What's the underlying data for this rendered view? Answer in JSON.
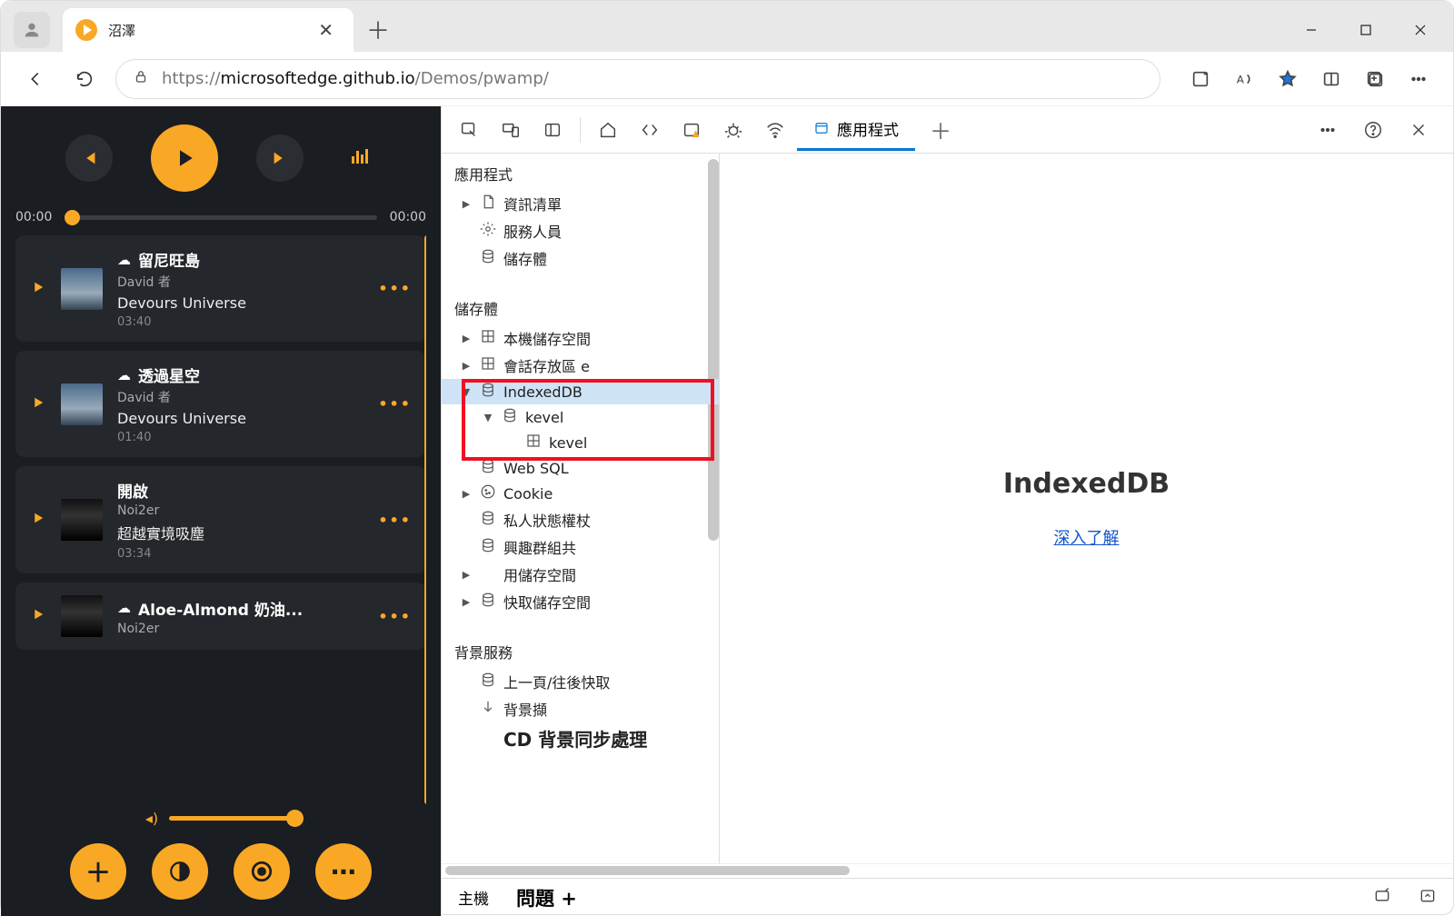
{
  "browser": {
    "tab_title": "沼澤",
    "url_prefix": "https://",
    "url_black": "microsoftedge.github.io",
    "url_rest": "/Demos/pwamp/"
  },
  "pwamp": {
    "t_elapsed": "00:00",
    "t_total": "00:00",
    "songs": [
      {
        "title": "留尼旺島",
        "artist": "David",
        "suffix": "者",
        "album": "Devours Universe",
        "dur": "03:40",
        "cloud": true,
        "cover": "light"
      },
      {
        "title": "透過星空",
        "artist": "David",
        "suffix": "者",
        "album": "Devours Universe",
        "dur": "01:40",
        "cloud": true,
        "cover": "light"
      },
      {
        "title": "開啟",
        "artist": "Noi2er",
        "suffix": "",
        "album": "超越實境吸塵",
        "dur": "03:34",
        "cloud": false,
        "cover": "dark"
      },
      {
        "title": "Aloe-Almond 奶油...",
        "artist": "Noi2er",
        "suffix": "",
        "album": "",
        "dur": "",
        "cloud": true,
        "cover": "dark"
      }
    ]
  },
  "devtools": {
    "tab_active": "應用程式",
    "main_title": "IndexedDB",
    "main_link": "深入了解",
    "drawer_main": "主機",
    "drawer_issues": "問題",
    "side": {
      "app_header": "應用程式",
      "app_items": [
        "資訊清單",
        "服務人員",
        "儲存體"
      ],
      "storage_header": "儲存體",
      "storage_items": [
        {
          "label": "本機儲存空間",
          "expand": "▶",
          "level": 1,
          "icon": "grid"
        },
        {
          "label": "會話存放區 e",
          "expand": "▶",
          "level": 1,
          "icon": "grid"
        },
        {
          "label": "IndexedDB",
          "expand": "▼",
          "level": 1,
          "sel": true,
          "icon": "db"
        },
        {
          "label": "kevel",
          "expand": "▼",
          "level": 2,
          "icon": "db"
        },
        {
          "label": "kevel",
          "expand": "",
          "level": 3,
          "icon": "grid"
        },
        {
          "label": "Web SQL",
          "expand": "",
          "level": 1,
          "icon": "db"
        },
        {
          "label": "Cookie",
          "expand": "▶",
          "level": 1,
          "icon": "cookie"
        },
        {
          "label": "私人狀態權杖",
          "expand": "",
          "level": 1,
          "icon": "db"
        },
        {
          "label": "興趣群組共",
          "expand": "",
          "level": 1,
          "icon": "db"
        },
        {
          "label": "用儲存空間",
          "expand": "▶",
          "level": 1,
          "icon": "blank"
        },
        {
          "label": "快取儲存空間",
          "expand": "▶",
          "level": 1,
          "icon": "db"
        }
      ],
      "bg_header": "背景服務",
      "bg_items": [
        {
          "label": "上一頁/往後快取",
          "icon": "db"
        },
        {
          "label": "背景擷",
          "icon": "arrow"
        },
        {
          "label": "CD 背景同步處理",
          "icon": "",
          "big": true
        }
      ]
    }
  }
}
